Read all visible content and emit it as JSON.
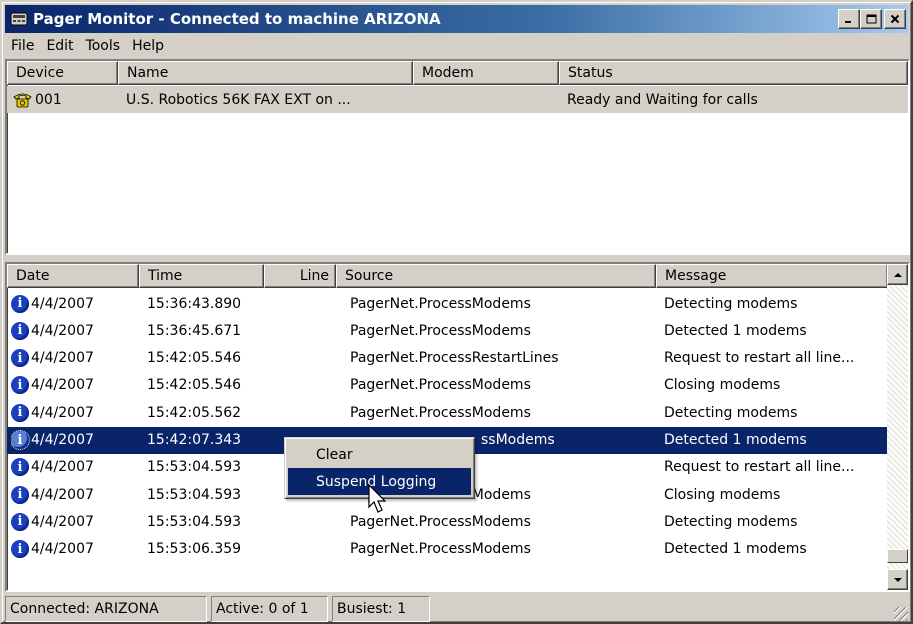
{
  "window": {
    "title": "Pager Monitor - Connected to machine ARIZONA",
    "minimize_glyph": "_",
    "maximize_glyph": "□",
    "close_glyph": "×"
  },
  "menubar": {
    "items": [
      "File",
      "Edit",
      "Tools",
      "Help"
    ]
  },
  "device_list": {
    "columns": [
      "Device",
      "Name",
      "Modem",
      "Status"
    ],
    "rows": [
      {
        "icon": "phone-icon",
        "device": "001",
        "name": "U.S. Robotics 56K FAX EXT on ...",
        "modem": "",
        "status": "Ready and Waiting for calls"
      }
    ]
  },
  "log_list": {
    "columns": [
      "Date",
      "Time",
      "Line",
      "Source",
      "Message"
    ],
    "rows": [
      {
        "icon": "info-icon",
        "date": "4/4/2007",
        "time": "15:36:43.890",
        "line": "",
        "source": "PagerNet.ProcessModems",
        "message": "Detecting modems",
        "selected": false
      },
      {
        "icon": "info-icon",
        "date": "4/4/2007",
        "time": "15:36:45.671",
        "line": "",
        "source": "PagerNet.ProcessModems",
        "message": "Detected 1  modems",
        "selected": false
      },
      {
        "icon": "info-icon",
        "date": "4/4/2007",
        "time": "15:42:05.546",
        "line": "",
        "source": "PagerNet.ProcessRestartLines",
        "message": "Request to restart all line...",
        "selected": false
      },
      {
        "icon": "info-icon",
        "date": "4/4/2007",
        "time": "15:42:05.546",
        "line": "",
        "source": "PagerNet.ProcessModems",
        "message": "Closing modems",
        "selected": false
      },
      {
        "icon": "info-icon",
        "date": "4/4/2007",
        "time": "15:42:05.562",
        "line": "",
        "source": "PagerNet.ProcessModems",
        "message": "Detecting modems",
        "selected": false
      },
      {
        "icon": "info-icon",
        "date": "4/4/2007",
        "time": "15:42:07.343",
        "line": "",
        "source": "ssModems",
        "message": "Detected 1  modems",
        "selected": true
      },
      {
        "icon": "info-icon",
        "date": "4/4/2007",
        "time": "15:53:04.593",
        "line": "",
        "source": "ssRestartLines",
        "message": "Request to restart all line...",
        "selected": false
      },
      {
        "icon": "info-icon",
        "date": "4/4/2007",
        "time": "15:53:04.593",
        "line": "",
        "source": "PagerNet.ProcessModems",
        "message": "Closing modems",
        "selected": false
      },
      {
        "icon": "info-icon",
        "date": "4/4/2007",
        "time": "15:53:04.593",
        "line": "",
        "source": "PagerNet.ProcessModems",
        "message": "Detecting modems",
        "selected": false
      },
      {
        "icon": "info-icon",
        "date": "4/4/2007",
        "time": "15:53:06.359",
        "line": "",
        "source": "PagerNet.ProcessModems",
        "message": "Detected 1  modems",
        "selected": false
      }
    ]
  },
  "context_menu": {
    "items": [
      {
        "label": "Clear",
        "highlighted": false
      },
      {
        "label": "Suspend Logging",
        "highlighted": true
      }
    ]
  },
  "statusbar": {
    "connected": "Connected: ARIZONA",
    "active": "Active: 0 of 1",
    "busiest": "Busiest: 1"
  },
  "colors": {
    "title_gradient_start": "#0a246a",
    "title_gradient_end": "#a6caf0",
    "selection": "#0a246a",
    "face": "#d4d0c8",
    "info_icon": "#1a3fbf",
    "phone_icon": "#e8c800"
  }
}
